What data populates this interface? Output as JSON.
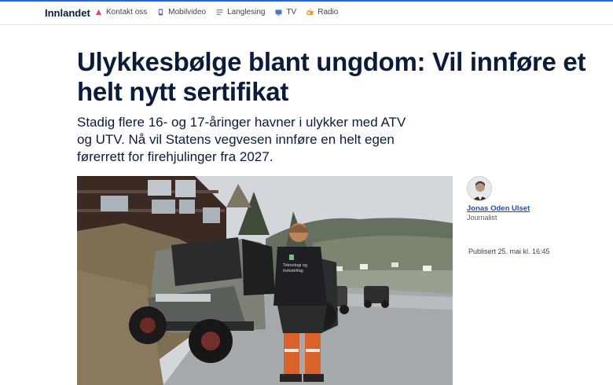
{
  "header": {
    "brand": "Innlandet",
    "nav": [
      {
        "label": "Kontakt oss",
        "icon": "contact-icon"
      },
      {
        "label": "Mobilvideo",
        "icon": "mobile-video-icon"
      },
      {
        "label": "Langlesing",
        "icon": "long-read-icon"
      },
      {
        "label": "TV",
        "icon": "tv-icon"
      },
      {
        "label": "Radio",
        "icon": "radio-icon"
      }
    ],
    "accent_color": "#1a64e8"
  },
  "article": {
    "headline": "Ulykkesbølge blant ungdom: Vil innføre et helt nytt sertifikat",
    "lead": "Stadig flere 16- og 17-åringer havner i ulykker med ATV og UTV. Nå vil Statens vegvesen innføre en helt egen førerrett for firehjulinger fra 2027.",
    "image": {
      "vest_text_1": "Teknologi og",
      "vest_text_2": "Industrifag"
    }
  },
  "byline": {
    "author": "Jonas Oden Ulset",
    "role": "Journalist",
    "published": "Publisert 25. mai kl. 16:45"
  }
}
